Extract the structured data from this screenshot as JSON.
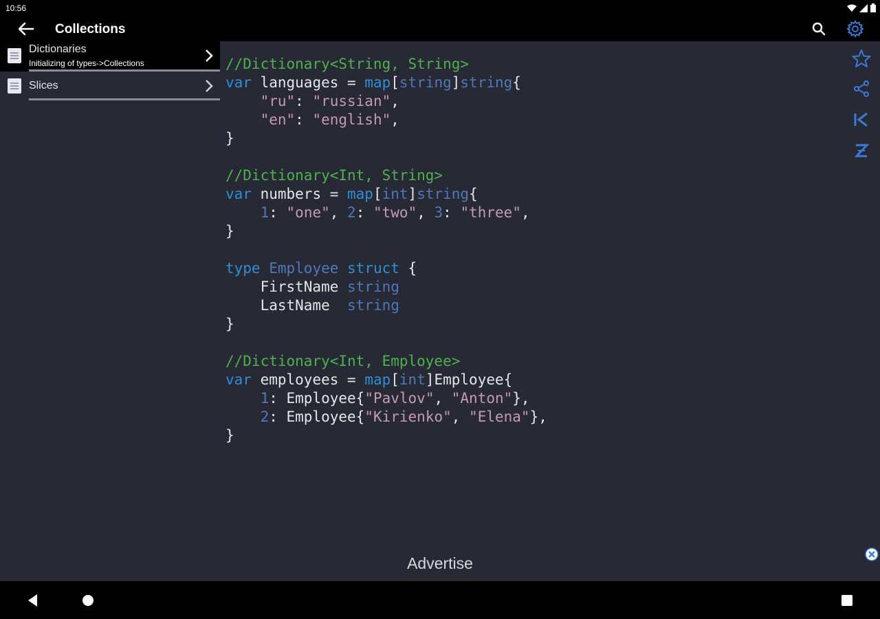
{
  "status_bar": {
    "time": "10:56"
  },
  "app_bar": {
    "title": "Collections"
  },
  "sidebar": {
    "items": [
      {
        "title": "Dictionaries",
        "subtitle": "Initializing of types->Collections"
      },
      {
        "title": "Slices"
      }
    ]
  },
  "code": {
    "lines": [
      [
        {
          "t": "//Dictionary<String, String>",
          "c": "c"
        }
      ],
      [
        {
          "t": "var",
          "c": "k"
        },
        {
          "t": " languages = ",
          "c": "pl"
        },
        {
          "t": "map",
          "c": "k"
        },
        {
          "t": "[",
          "c": "pl"
        },
        {
          "t": "string",
          "c": "t"
        },
        {
          "t": "]",
          "c": "pl"
        },
        {
          "t": "string",
          "c": "t"
        },
        {
          "t": "{",
          "c": "pl"
        }
      ],
      [
        {
          "t": "    ",
          "c": "pl"
        },
        {
          "t": "\"ru\"",
          "c": "s"
        },
        {
          "t": ": ",
          "c": "pl"
        },
        {
          "t": "\"russian\"",
          "c": "s"
        },
        {
          "t": ",",
          "c": "pl"
        }
      ],
      [
        {
          "t": "    ",
          "c": "pl"
        },
        {
          "t": "\"en\"",
          "c": "s"
        },
        {
          "t": ": ",
          "c": "pl"
        },
        {
          "t": "\"english\"",
          "c": "s"
        },
        {
          "t": ",",
          "c": "pl"
        }
      ],
      [
        {
          "t": "}",
          "c": "pl"
        }
      ],
      [
        {
          "t": "",
          "c": "pl"
        }
      ],
      [
        {
          "t": "//Dictionary<Int, String>",
          "c": "c"
        }
      ],
      [
        {
          "t": "var",
          "c": "k"
        },
        {
          "t": " numbers = ",
          "c": "pl"
        },
        {
          "t": "map",
          "c": "k"
        },
        {
          "t": "[",
          "c": "pl"
        },
        {
          "t": "int",
          "c": "t"
        },
        {
          "t": "]",
          "c": "pl"
        },
        {
          "t": "string",
          "c": "t"
        },
        {
          "t": "{",
          "c": "pl"
        }
      ],
      [
        {
          "t": "    ",
          "c": "pl"
        },
        {
          "t": "1",
          "c": "n"
        },
        {
          "t": ": ",
          "c": "pl"
        },
        {
          "t": "\"one\"",
          "c": "s"
        },
        {
          "t": ", ",
          "c": "pl"
        },
        {
          "t": "2",
          "c": "n"
        },
        {
          "t": ": ",
          "c": "pl"
        },
        {
          "t": "\"two\"",
          "c": "s"
        },
        {
          "t": ", ",
          "c": "pl"
        },
        {
          "t": "3",
          "c": "n"
        },
        {
          "t": ": ",
          "c": "pl"
        },
        {
          "t": "\"three\"",
          "c": "s"
        },
        {
          "t": ",",
          "c": "pl"
        }
      ],
      [
        {
          "t": "}",
          "c": "pl"
        }
      ],
      [
        {
          "t": "",
          "c": "pl"
        }
      ],
      [
        {
          "t": "type",
          "c": "k"
        },
        {
          "t": " ",
          "c": "pl"
        },
        {
          "t": "Employee",
          "c": "t"
        },
        {
          "t": " ",
          "c": "pl"
        },
        {
          "t": "struct",
          "c": "k"
        },
        {
          "t": " {",
          "c": "pl"
        }
      ],
      [
        {
          "t": "    FirstName ",
          "c": "pl"
        },
        {
          "t": "string",
          "c": "t"
        }
      ],
      [
        {
          "t": "    LastName  ",
          "c": "pl"
        },
        {
          "t": "string",
          "c": "t"
        }
      ],
      [
        {
          "t": "}",
          "c": "pl"
        }
      ],
      [
        {
          "t": "",
          "c": "pl"
        }
      ],
      [
        {
          "t": "//Dictionary<Int, Employee>",
          "c": "c"
        }
      ],
      [
        {
          "t": "var",
          "c": "k"
        },
        {
          "t": " employees = ",
          "c": "pl"
        },
        {
          "t": "map",
          "c": "k"
        },
        {
          "t": "[",
          "c": "pl"
        },
        {
          "t": "int",
          "c": "t"
        },
        {
          "t": "]Employee{",
          "c": "pl"
        }
      ],
      [
        {
          "t": "    ",
          "c": "pl"
        },
        {
          "t": "1",
          "c": "n"
        },
        {
          "t": ": Employee{",
          "c": "pl"
        },
        {
          "t": "\"Pavlov\"",
          "c": "s"
        },
        {
          "t": ", ",
          "c": "pl"
        },
        {
          "t": "\"Anton\"",
          "c": "s"
        },
        {
          "t": "},",
          "c": "pl"
        }
      ],
      [
        {
          "t": "    ",
          "c": "pl"
        },
        {
          "t": "2",
          "c": "n"
        },
        {
          "t": ": Employee{",
          "c": "pl"
        },
        {
          "t": "\"Kirienko\"",
          "c": "s"
        },
        {
          "t": ", ",
          "c": "pl"
        },
        {
          "t": "\"Elena\"",
          "c": "s"
        },
        {
          "t": "},",
          "c": "pl"
        }
      ],
      [
        {
          "t": "}",
          "c": "pl"
        }
      ]
    ]
  },
  "right_toolbar": {
    "icons": [
      "star-icon",
      "share-icon",
      "first-letter-k-icon",
      "last-letter-z-icon"
    ]
  },
  "ad": {
    "label": "Advertise"
  },
  "colors": {
    "background": "#272a35",
    "bar": "#000000",
    "accent": "#3a7bd5",
    "comment": "#4fb04f",
    "keyword": "#2e8fd6",
    "string": "#c59ab0"
  }
}
